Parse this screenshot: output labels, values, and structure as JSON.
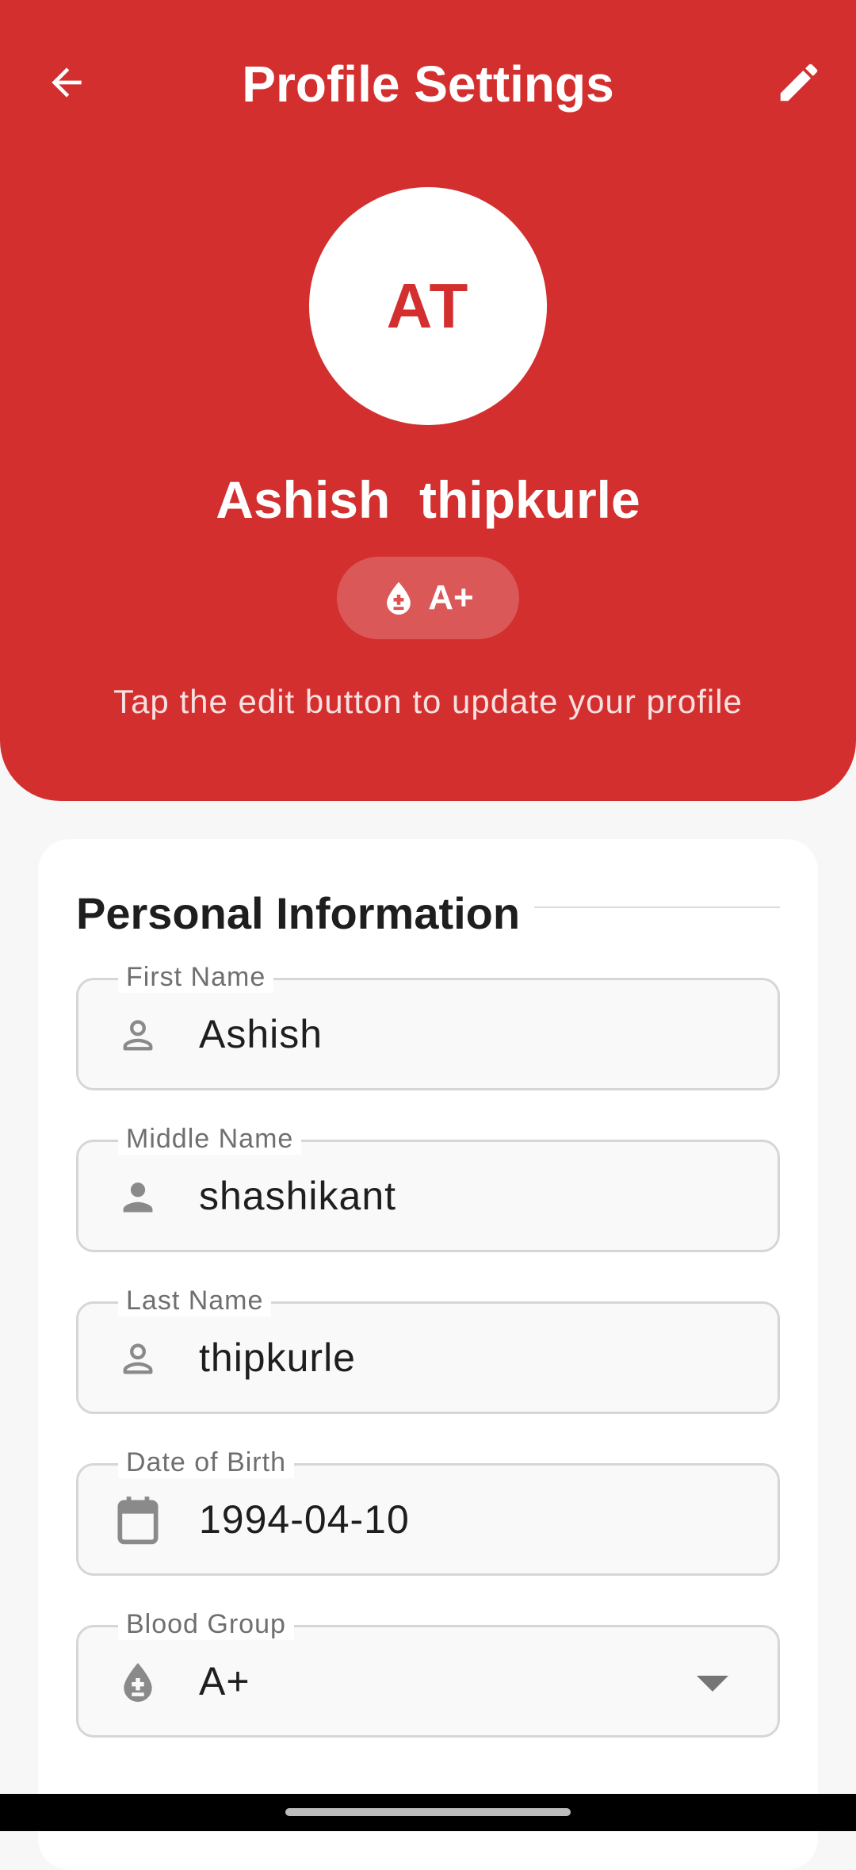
{
  "app": {
    "title": "Profile Settings",
    "accent_color": "#d32f2f"
  },
  "profile": {
    "initials": "AT",
    "full_name": "Ashish  thipkurle",
    "blood_group": "A+",
    "hint": "Tap the edit button to update your profile"
  },
  "form": {
    "section_title": "Personal Information",
    "fields": [
      {
        "label": "First Name",
        "value": "Ashish",
        "icon": "person-outline-icon"
      },
      {
        "label": "Middle Name",
        "value": "shashikant",
        "icon": "person-filled-icon"
      },
      {
        "label": "Last Name",
        "value": "thipkurle",
        "icon": "person-outline-icon"
      },
      {
        "label": "Date of Birth",
        "value": "1994-04-10",
        "icon": "calendar-icon"
      },
      {
        "label": "Blood Group",
        "value": "A+",
        "icon": "blood-drop-icon"
      }
    ]
  },
  "icons": {
    "back": "arrow-back-icon",
    "edit": "pencil-icon",
    "dropdown": "dropdown-arrow-icon"
  }
}
